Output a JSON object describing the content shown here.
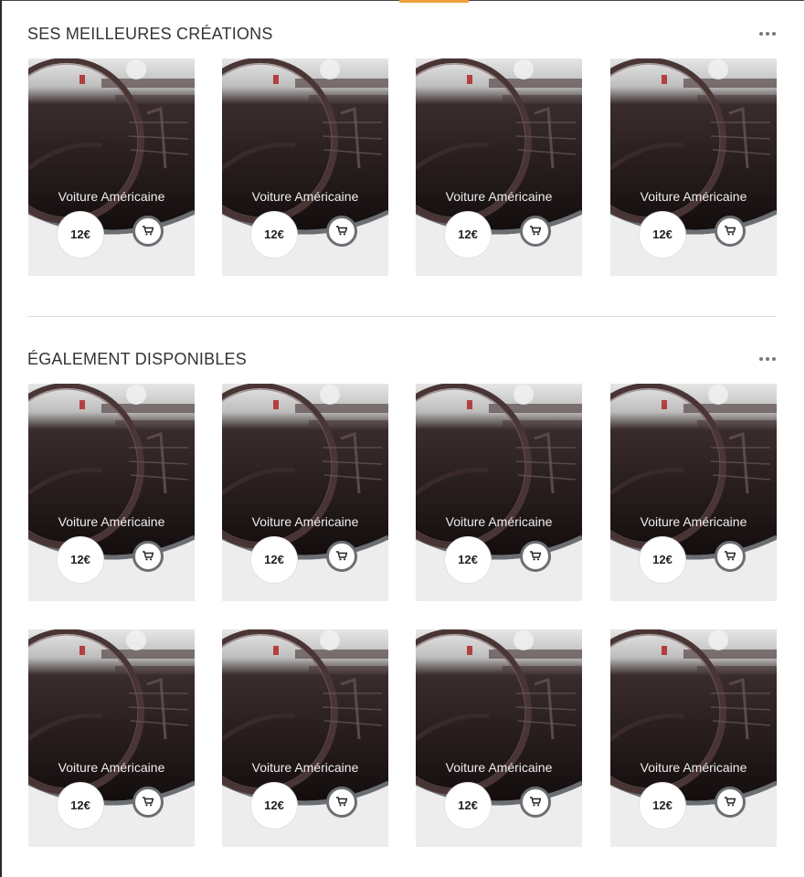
{
  "sections": [
    {
      "title": "SES MEILLEURES CRÉATIONS",
      "products": [
        {
          "name": "Voiture Américaine",
          "price": "12€",
          "image": "car-dashboard-photo"
        },
        {
          "name": "Voiture Américaine",
          "price": "12€",
          "image": "car-dashboard-photo"
        },
        {
          "name": "Voiture Américaine",
          "price": "12€",
          "image": "car-dashboard-photo"
        },
        {
          "name": "Voiture Américaine",
          "price": "12€",
          "image": "car-dashboard-photo"
        }
      ]
    },
    {
      "title": "ÉGALEMENT DISPONIBLES",
      "products": [
        {
          "name": "Voiture Américaine",
          "price": "12€",
          "image": "car-dashboard-photo"
        },
        {
          "name": "Voiture Américaine",
          "price": "12€",
          "image": "car-dashboard-photo"
        },
        {
          "name": "Voiture Américaine",
          "price": "12€",
          "image": "car-dashboard-photo"
        },
        {
          "name": "Voiture Américaine",
          "price": "12€",
          "image": "car-dashboard-photo"
        },
        {
          "name": "Voiture Américaine",
          "price": "12€",
          "image": "car-dashboard-photo"
        },
        {
          "name": "Voiture Américaine",
          "price": "12€",
          "image": "car-dashboard-photo"
        },
        {
          "name": "Voiture Américaine",
          "price": "12€",
          "image": "car-dashboard-photo"
        },
        {
          "name": "Voiture Américaine",
          "price": "12€",
          "image": "car-dashboard-photo"
        }
      ]
    }
  ],
  "icons": {
    "more": "more-horizontal-icon",
    "cart": "cart-icon"
  },
  "colors": {
    "accent": "#f0a040",
    "card_bg": "#ededed",
    "cart_ring": "#6b6f73"
  }
}
